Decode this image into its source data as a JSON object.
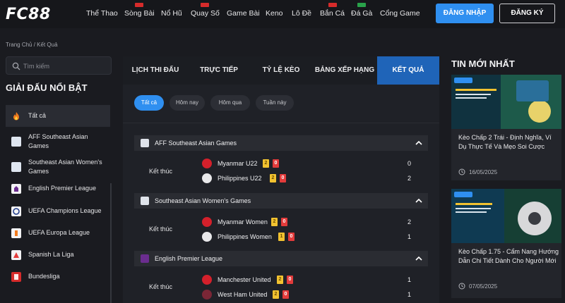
{
  "header": {
    "logo": "FC88",
    "nav": [
      {
        "label": "Thể Thao",
        "badge": ""
      },
      {
        "label": "Sòng Bài",
        "badge": "red"
      },
      {
        "label": "Nổ Hũ",
        "badge": ""
      },
      {
        "label": "Quay Số",
        "badge": "red"
      },
      {
        "label": "Game Bài",
        "badge": ""
      },
      {
        "label": "Keno",
        "badge": ""
      },
      {
        "label": "Lô Đề",
        "badge": ""
      },
      {
        "label": "Bắn Cá",
        "badge": "red"
      },
      {
        "label": "Đá Gà",
        "badge": "green"
      },
      {
        "label": "Cổng Game",
        "badge": ""
      }
    ],
    "login_label": "ĐĂNG NHẬP",
    "register_label": "ĐĂNG KÝ"
  },
  "breadcrumb": "Trang Chủ  /  Kết Quả",
  "search": {
    "placeholder": "Tìm kiếm"
  },
  "featured": {
    "title": "GIẢI ĐẤU NỔI BẬT",
    "items": [
      {
        "label": "Tất cả",
        "icon": "fire-icon",
        "color": "#f07a1e"
      },
      {
        "label": "AFF Southeast Asian Games",
        "icon": "aff-logo-icon",
        "color": "#dfe6f0"
      },
      {
        "label": "Southeast Asian Women's Games",
        "icon": "aff-logo-icon",
        "color": "#dfe6f0"
      },
      {
        "label": "English Premier League",
        "icon": "premier-league-icon",
        "color": "#6b2d8f"
      },
      {
        "label": "UEFA Champions League",
        "icon": "champions-league-icon",
        "color": "#1e3a8a"
      },
      {
        "label": "UEFA Europa League",
        "icon": "europa-league-icon",
        "color": "#f07a1e"
      },
      {
        "label": "Spanish La Liga",
        "icon": "la-liga-icon",
        "color": "#e23b3b"
      },
      {
        "label": "Bundesliga",
        "icon": "bundesliga-icon",
        "color": "#d62b2b"
      }
    ]
  },
  "tabs": [
    "LỊCH THI ĐẤU",
    "TRỰC TIẾP",
    "TỶ LỆ KÈO",
    "BẢNG XẾP HẠNG",
    "KẾT QUẢ"
  ],
  "filters": [
    "Tất cả",
    "Hôm nay",
    "Hôm qua",
    "Tuần này"
  ],
  "results": [
    {
      "league": "AFF Southeast Asian Games",
      "status": "Kết thúc",
      "teams": [
        {
          "name": "Myanmar U22",
          "yellow": "2",
          "red": "0",
          "score": "0",
          "logo_color": "#d4202b"
        },
        {
          "name": "Philippines U22",
          "yellow": "2",
          "red": "0",
          "score": "2",
          "logo_color": "#e8e8ea"
        }
      ]
    },
    {
      "league": "Southeast Asian Women's Games",
      "status": "Kết thúc",
      "teams": [
        {
          "name": "Myanmar Women",
          "yellow": "2",
          "red": "0",
          "score": "2",
          "logo_color": "#d4202b"
        },
        {
          "name": "Philippines Women",
          "yellow": "1",
          "red": "0",
          "score": "1",
          "logo_color": "#e8e8ea"
        }
      ]
    },
    {
      "league": "English Premier League",
      "status": "Kết thúc",
      "teams": [
        {
          "name": "Manchester United",
          "yellow": "2",
          "red": "0",
          "score": "1",
          "logo_color": "#d4202b"
        },
        {
          "name": "West Ham United",
          "yellow": "2",
          "red": "0",
          "score": "1",
          "logo_color": "#7a2636"
        }
      ]
    }
  ],
  "news": {
    "title": "TIN MỚI NHẤT",
    "items": [
      {
        "headline": "Kèo Chấp 2 Trái - Định Nghĩa, Ví Dụ Thực Tế Và Mẹo Soi Cược",
        "date": "16/05/2025",
        "thumb_caption": "KÈO CHẤP 2 TRÁI"
      },
      {
        "headline": "Kèo Chấp 1.75 - Cẩm Nang Hướng Dẫn Chi Tiết Dành Cho Người Mới",
        "date": "07/05/2025",
        "thumb_caption": "KÈO CHẤP 1.75"
      }
    ]
  }
}
